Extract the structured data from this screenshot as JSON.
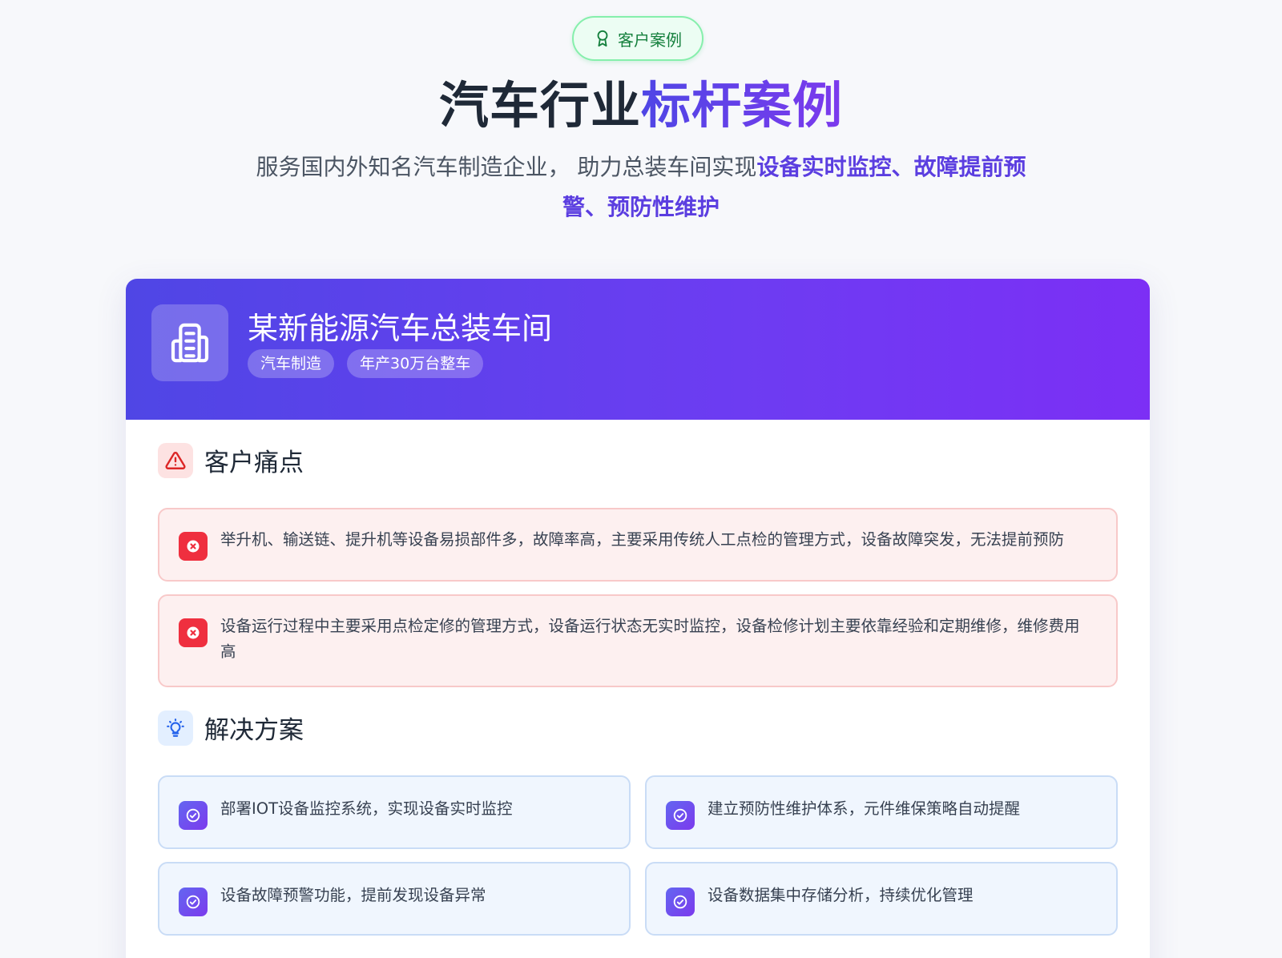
{
  "hero": {
    "badge_label": "客户案例",
    "title_plain": "汽车行业",
    "title_accent": "标杆案例",
    "subtitle_plain": "服务国内外知名汽车制造企业， 助力总装车间实现",
    "subtitle_highlight": "设备实时监控、故障提前预警、预防性维护"
  },
  "case": {
    "company_name": "某新能源汽车总装车间",
    "tags": [
      "汽车制造",
      "年产30万台整车"
    ],
    "pain_section_title": "客户痛点",
    "pain_points": [
      "举升机、输送链、提升机等设备易损部件多，故障率高，主要采用传统人工点检的管理方式，设备故障突发，无法提前预防",
      "设备运行过程中主要采用点检定修的管理方式，设备运行状态无实时监控，设备检修计划主要依靠经验和定期维修，维修费用高"
    ],
    "solution_section_title": "解决方案",
    "solutions": [
      "部署IOT设备监控系统，实现设备实时监控",
      "建立预防性维护体系，元件维保策略自动提醒",
      "设备故障预警功能，提前发现设备异常",
      "设备数据集中存储分析，持续优化管理"
    ]
  },
  "colors": {
    "brand_gradient_start": "#4f46e5",
    "brand_gradient_end": "#7c2ff5",
    "pain_red": "#ef2f3f",
    "badge_green": "#15803d"
  },
  "icons": {
    "badge": "award-icon",
    "company": "building-icon",
    "pain_section": "alert-triangle-icon",
    "pain_item": "x-circle-icon",
    "solution_section": "lightbulb-icon",
    "solution_item": "check-circle-icon"
  }
}
